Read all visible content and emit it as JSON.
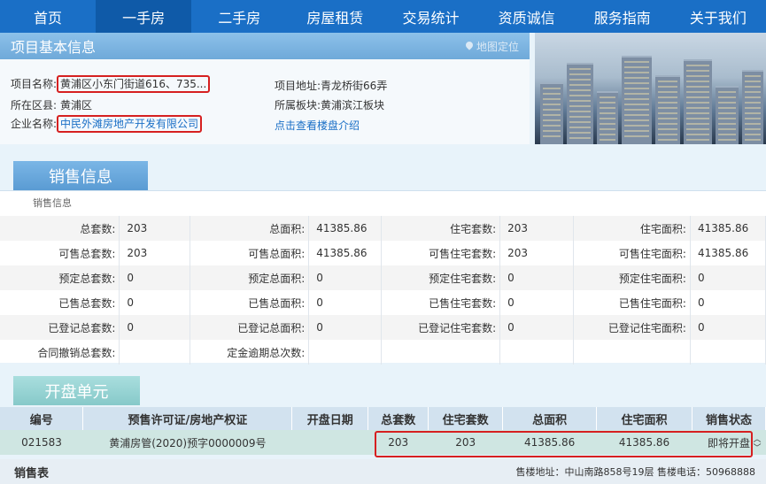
{
  "nav": {
    "items": [
      "首页",
      "一手房",
      "二手房",
      "房屋租赁",
      "交易统计",
      "资质诚信",
      "服务指南",
      "关于我们"
    ],
    "active_index": 1
  },
  "project": {
    "header_title": "项目基本信息",
    "map_link": "地图定位",
    "name_label": "项目名称:",
    "name_value": "黄浦区小东门街道616、735...",
    "district_label": "所在区县:",
    "district_value": "黄浦区",
    "company_label": "企业名称:",
    "company_value": "中民外滩房地产开发有限公司",
    "address_label": "项目地址:",
    "address_value": "青龙桥街66弄",
    "block_label": "所属板块:",
    "block_value": "黄浦滨江板块",
    "intro_link": "点击查看楼盘介绍"
  },
  "sales": {
    "tab_label": "销售信息",
    "sub_title": "销售信息",
    "rows": [
      [
        [
          "总套数:",
          "203"
        ],
        [
          "总面积:",
          "41385.86"
        ],
        [
          "住宅套数:",
          "203"
        ],
        [
          "住宅面积:",
          "41385.86"
        ]
      ],
      [
        [
          "可售总套数:",
          "203"
        ],
        [
          "可售总面积:",
          "41385.86"
        ],
        [
          "可售住宅套数:",
          "203"
        ],
        [
          "可售住宅面积:",
          "41385.86"
        ]
      ],
      [
        [
          "预定总套数:",
          "0"
        ],
        [
          "预定总面积:",
          "0"
        ],
        [
          "预定住宅套数:",
          "0"
        ],
        [
          "预定住宅面积:",
          "0"
        ]
      ],
      [
        [
          "已售总套数:",
          "0"
        ],
        [
          "已售总面积:",
          "0"
        ],
        [
          "已售住宅套数:",
          "0"
        ],
        [
          "已售住宅面积:",
          "0"
        ]
      ],
      [
        [
          "已登记总套数:",
          "0"
        ],
        [
          "已登记总面积:",
          "0"
        ],
        [
          "已登记住宅套数:",
          "0"
        ],
        [
          "已登记住宅面积:",
          "0"
        ]
      ],
      [
        [
          "合同撤销总套数:",
          ""
        ],
        [
          "定金逾期总次数:",
          ""
        ],
        [
          "",
          ""
        ],
        [
          "",
          ""
        ]
      ]
    ]
  },
  "units": {
    "tab_label": "开盘单元",
    "headers": [
      "编号",
      "预售许可证/房地产权证",
      "开盘日期",
      "总套数",
      "住宅套数",
      "总面积",
      "住宅面积",
      "销售状态"
    ],
    "rows": [
      [
        "021583",
        "黄浦房管(2020)预字0000009号",
        "",
        "203",
        "203",
        "41385.86",
        "41385.86",
        "即将开盘"
      ]
    ]
  },
  "footer": {
    "title": "销售表",
    "address": "售楼地址：中山南路858号19层 售楼电话：50968888"
  },
  "colors": {
    "nav_bg": "#1a6fc6",
    "highlight_red": "#d62020",
    "status_red": "#d62020"
  }
}
